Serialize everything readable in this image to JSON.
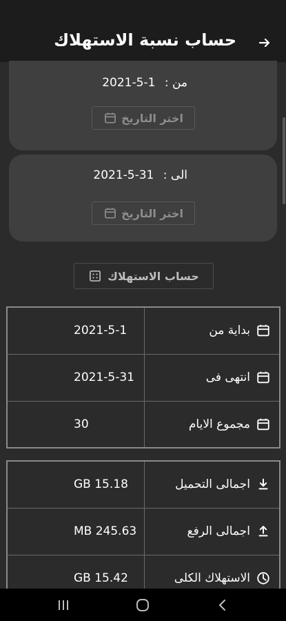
{
  "header": {
    "title": "حساب نسبة الاستهلاك",
    "back_icon": "arrow-right-icon"
  },
  "from_card": {
    "label": "من :",
    "date": "2021-5-1",
    "pick_label": "اختر التاريخ"
  },
  "to_card": {
    "label": "الى :",
    "date": "2021-5-31",
    "pick_label": "اختر التاريخ"
  },
  "calc_button": {
    "label": "حساب الاستهلاك",
    "icon": "calculator-icon"
  },
  "period_table": [
    {
      "label": "بداية من",
      "value": "2021-5-1",
      "icon": "calendar-icon"
    },
    {
      "label": "انتهى فى",
      "value": "2021-5-31",
      "icon": "calendar-icon"
    },
    {
      "label": "مجموع الايام",
      "value": "30",
      "icon": "calendar-icon"
    }
  ],
  "usage_table": [
    {
      "label": "اجمالى التحميل",
      "value": "GB 15.18",
      "icon": "download-icon"
    },
    {
      "label": "اجمالى الرفع",
      "value": "MB 245.63",
      "icon": "upload-icon"
    },
    {
      "label": "الاستهلاك الكلى",
      "value": "GB 15.42",
      "icon": "data-usage-icon"
    }
  ],
  "colors": {
    "background": "#2b2b2b",
    "appbar": "#1c1c1c",
    "card": "#3f3f3f",
    "muted_text": "#8e8e8e"
  }
}
